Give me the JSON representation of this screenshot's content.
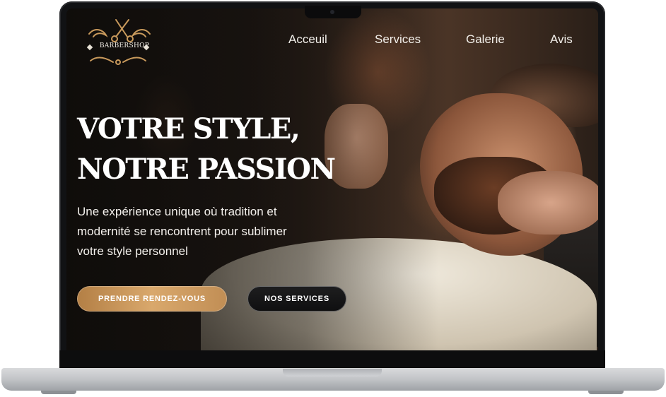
{
  "brand": {
    "name": "BARBERSHOP",
    "accent": "#c99a5c"
  },
  "nav": {
    "items": [
      {
        "label": "Acceuil"
      },
      {
        "label": "Services"
      },
      {
        "label": "Galerie"
      },
      {
        "label": "Avis"
      }
    ]
  },
  "hero": {
    "title_line1": "VOTRE STYLE,",
    "title_line2": "NOTRE PASSION",
    "subtitle_line1": "Une expérience unique où tradition et",
    "subtitle_line2": "modernité se rencontrent pour sublimer",
    "subtitle_line3": "votre style personnel",
    "primary_button": "PRENDRE RENDEZ-VOUS",
    "secondary_button": "NOS SERVICES"
  }
}
